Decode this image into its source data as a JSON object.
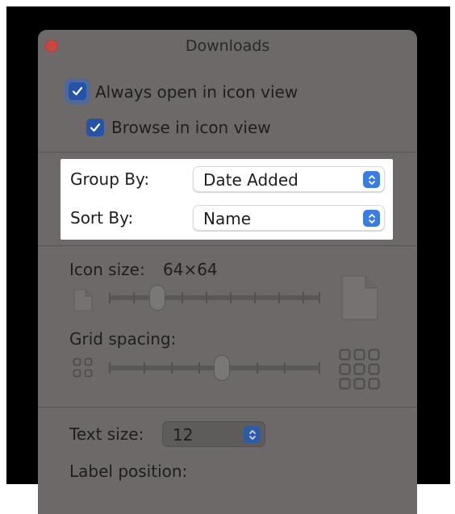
{
  "window": {
    "title": "Downloads"
  },
  "view_options": {
    "always_open_in_icon_view": {
      "label": "Always open in icon view",
      "checked": true
    },
    "browse_in_icon_view": {
      "label": "Browse in icon view",
      "checked": true
    }
  },
  "grouping": {
    "group_by": {
      "label": "Group By:",
      "value": "Date Added"
    },
    "sort_by": {
      "label": "Sort By:",
      "value": "Name"
    }
  },
  "icon_size": {
    "label": "Icon size:",
    "value": "64×64",
    "slider_level": 0.25
  },
  "grid_spacing": {
    "label": "Grid spacing:",
    "slider_level": 0.5
  },
  "text_size": {
    "label": "Text size:",
    "value": "12"
  },
  "label_position": {
    "label": "Label position:"
  },
  "colors": {
    "accent": "#3b7ce3",
    "close": "#c94843",
    "panel": "#6d6969"
  }
}
